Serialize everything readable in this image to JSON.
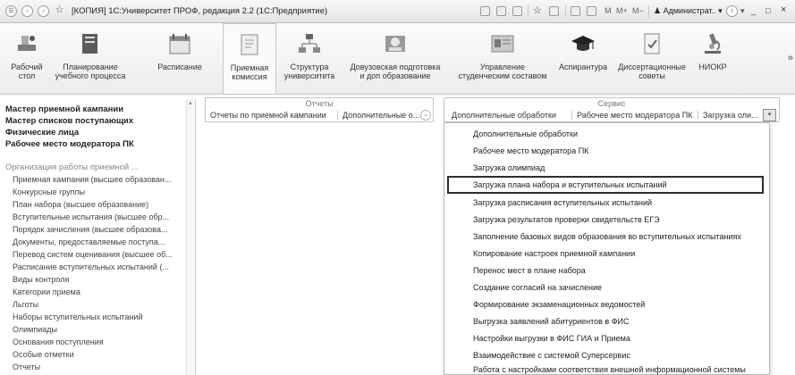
{
  "window": {
    "title": "[КОПИЯ] 1С:Университет ПРОФ, редакция 2.2  (1С:Предприятие)",
    "nav_back_icon": "circle-back-icon",
    "nav_forward_icon": "circle-forward-icon",
    "m_label": "M",
    "mplus_label": "M+",
    "mminus_label": "M−",
    "user_label": "Администрат..",
    "info_label": "i",
    "minimize_label": "_",
    "maximize_label": "□",
    "close_label": "×"
  },
  "sections": [
    {
      "label": "Рабочий\nстол",
      "icon": "desktop-icon"
    },
    {
      "label": "Планирование\nучебного процесса",
      "icon": "planning-icon"
    },
    {
      "label": "Расписание",
      "icon": "schedule-icon"
    },
    {
      "label": "Приемная\nкомиссия",
      "icon": "admission-icon",
      "active": true
    },
    {
      "label": "Структура\nуниверситета",
      "icon": "structure-icon"
    },
    {
      "label": "Довузовская подготовка\nи доп образование",
      "icon": "prep-icon"
    },
    {
      "label": "Управление\nстуденческим составом",
      "icon": "students-icon"
    },
    {
      "label": "Аспирантура",
      "icon": "graduate-cap-icon"
    },
    {
      "label": "Диссертационные\nсоветы",
      "icon": "dissertation-icon"
    },
    {
      "label": "НИОКР",
      "icon": "microscope-icon"
    }
  ],
  "sections_more": "»",
  "left_nav": {
    "bold_items": [
      "Мастер приемной кампании",
      "Мастер списков поступающих",
      "Физические лица",
      "Рабочее место модератора ПК"
    ],
    "group_title": "Организация работы приемной ...",
    "items": [
      "Приемная кампания (высшее образован...",
      "Конкурсные группы",
      "План набора (высшее образование)",
      "Вступительные испытания (высшее обр...",
      "Порядок зачисления (высшее образова...",
      "Документы, предоставляемые поступа...",
      "Перевод систем оценивания (высшее об...",
      "Расписание вступительных испытаний (...",
      "Виды контроля",
      "Категории приема",
      "Льготы",
      "Наборы вступительных испытаний",
      "Олимпиады",
      "Основания поступления",
      "Особые отметки",
      "Отчеты"
    ]
  },
  "reports_panel": {
    "title": "Отчеты",
    "item1": "Отчеты по приемной кампании",
    "item2": "Дополнительные о...",
    "more": "⌄"
  },
  "service_panel": {
    "title": "Сервис",
    "item1": "Дополнительные обработки",
    "item2": "Рабочее место модератора ПК",
    "item3": "Загрузка оли...",
    "more": "▾"
  },
  "dropdown": {
    "items": [
      "Дополнительные обработки",
      "Рабочее место модератора ПК",
      "Загрузка олимпиад",
      "Загрузка плана набора и вступительных испытаний",
      "Загрузка расписания вступительных испытаний",
      "Загрузка результатов проверки свидетельств ЕГЭ",
      "Заполнение базовых видов образования во вступительных испытаниях",
      "Копирование настроек приемной кампании",
      "Перенос мест в плане набора",
      "Создание согласий на зачисление",
      "Формирование экзаменационных ведомостей",
      "Выгрузка заявлений абитуриентов в ФИС",
      "Настройки выгрузки в ФИС ГИА и Приема",
      "Взаимодействие с системой Суперсервис",
      "Работа с настройками соответствия внешней информационной системы"
    ],
    "highlighted": "Загрузка плана набора и вступительных испытаний"
  }
}
